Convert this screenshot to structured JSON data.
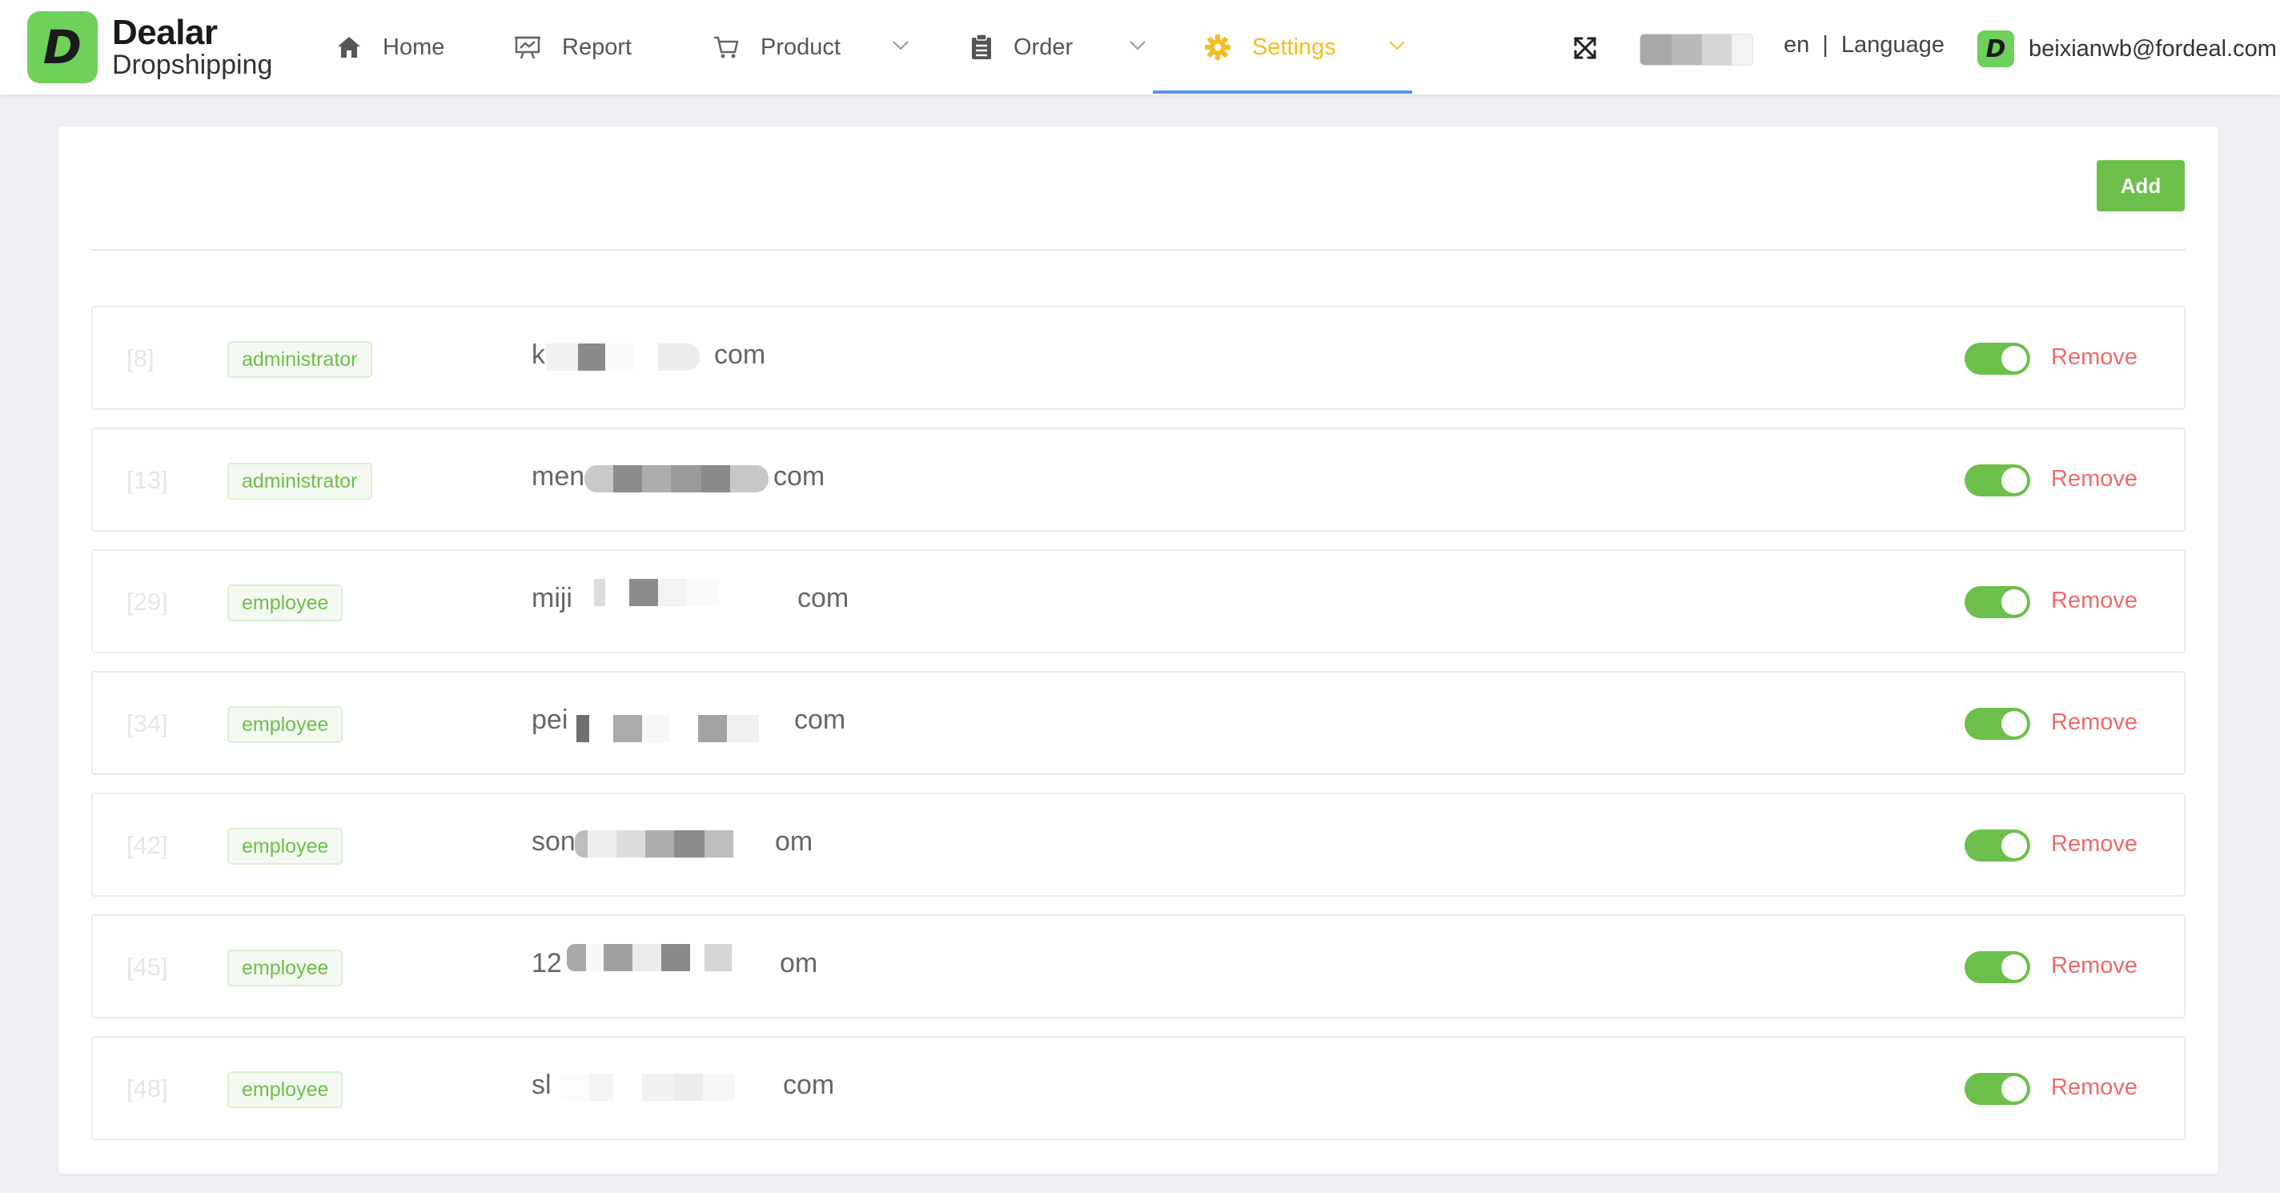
{
  "brand": {
    "title": "Dealar",
    "subtitle": "Dropshipping",
    "badge_letter": "D",
    "color": "#6fd05c"
  },
  "nav": {
    "home": "Home",
    "report": "Report",
    "product": "Product",
    "order": "Order",
    "settings": "Settings",
    "active": "settings",
    "active_color": "#f5bd1c",
    "underline_color": "#5b93e6"
  },
  "header": {
    "language_code": "en",
    "separator": "|",
    "language_label": "Language",
    "user_badge": "D",
    "user_email": "beixianwb@fordeal.com"
  },
  "toolbar": {
    "add_label": "Add",
    "add_color": "#6cbf4a"
  },
  "members": [
    {
      "id": "[8]",
      "role": "administrator",
      "email_start": "k",
      "email_end": "com",
      "enabled": true,
      "remove_label": "Remove"
    },
    {
      "id": "[13]",
      "role": "administrator",
      "email_start": "men",
      "email_end": "com",
      "enabled": true,
      "remove_label": "Remove"
    },
    {
      "id": "[29]",
      "role": "employee",
      "email_start": "miji",
      "email_end": "com",
      "enabled": true,
      "remove_label": "Remove"
    },
    {
      "id": "[34]",
      "role": "employee",
      "email_start": "pei",
      "email_end": "com",
      "enabled": true,
      "remove_label": "Remove"
    },
    {
      "id": "[42]",
      "role": "employee",
      "email_start": "son",
      "email_end": "om",
      "enabled": true,
      "remove_label": "Remove"
    },
    {
      "id": "[45]",
      "role": "employee",
      "email_start": "12",
      "email_end": "om",
      "enabled": true,
      "remove_label": "Remove"
    },
    {
      "id": "[48]",
      "role": "employee",
      "email_start": "sl",
      "email_end": "com",
      "enabled": true,
      "remove_label": "Remove"
    }
  ],
  "colors": {
    "remove": "#ef6a6a",
    "toggle_on": "#6cbf4a",
    "tag_text": "#6cbf4a"
  }
}
